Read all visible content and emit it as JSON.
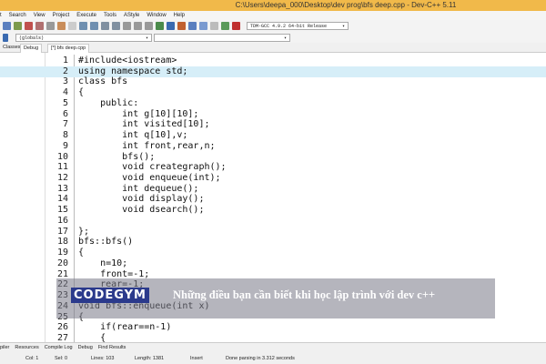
{
  "window": {
    "title": "C:\\Users\\deepa_000\\Desktop\\dev prog\\bfs deep.cpp - Dev-C++ 5.11"
  },
  "menu": [
    "t",
    "Search",
    "View",
    "Project",
    "Execute",
    "Tools",
    "AStyle",
    "Window",
    "Help"
  ],
  "toolbar": {
    "compiler": "TDM-GCC 4.9.2 64-bit Release",
    "scope": "(globals)",
    "member": ""
  },
  "tabs": {
    "classes": "Classes",
    "debug": "Debug",
    "file": "[*] bfs deep.cpp"
  },
  "code": [
    "#include<iostream>",
    "using namespace std;",
    "class bfs",
    "{",
    "    public:",
    "        int g[10][10];",
    "        int visited[10];",
    "        int q[10],v;",
    "        int front,rear,n;",
    "        bfs();",
    "        void creategraph();",
    "        void enqueue(int);",
    "        int dequeue();",
    "        void display();",
    "        void dsearch();",
    "",
    "};",
    "bfs::bfs()",
    "{",
    "    n=10;",
    "    front=-1;",
    "    rear=-1;",
    "}",
    "void bfs::enqueue(int x)",
    "{",
    "    if(rear==n-1)",
    "    {"
  ],
  "bottom_tabs": [
    "piler",
    "Resources",
    "Compile Log",
    "Debug",
    "Find Results"
  ],
  "status": {
    "col": "Col:  1",
    "sel": "Sel:  0",
    "lines": "Lines:  103",
    "length": "Length:  1381",
    "mode": "Insert",
    "message": "Done parsing in 3.312 seconds"
  },
  "banner": {
    "logo": "CODEGYM",
    "text": "Những điều bạn cần biết khi học lập trình với dev c++"
  }
}
